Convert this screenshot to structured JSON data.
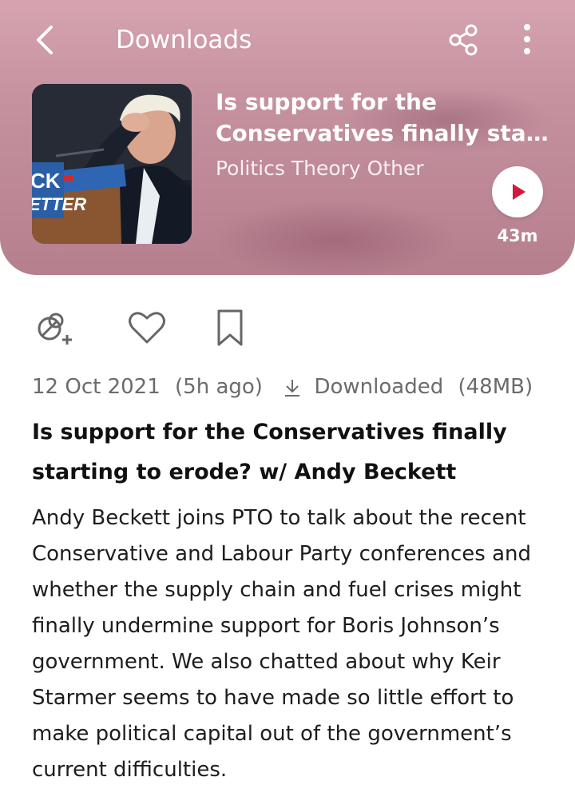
{
  "header": {
    "title": "Downloads"
  },
  "episode": {
    "title_line1": "Is support for the",
    "title_line2": "Conservatives finally starting to erode? w/ Andy Beckett",
    "podcast": "Politics Theory Other",
    "duration": "43m",
    "artwork_text_top": "CK",
    "artwork_text_bottom": "ETTER"
  },
  "meta": {
    "date": "12 Oct 2021",
    "ago": "(5h ago)",
    "status": "Downloaded",
    "size": "(48MB)"
  },
  "body": {
    "title": "Is support for the Conservatives finally starting to erode? w/ Andy Beckett",
    "description": "Andy Beckett joins PTO to talk about the recent Conservative and Labour Party conferences and whether the supply chain and fuel crises might finally undermine support for Boris Johnson’s government. We also chatted about why Keir Starmer seems to have made so little effort to make political capital out of the government’s current difficulties."
  },
  "icons": {
    "back": "back-arrow-icon",
    "share": "share-icon",
    "more": "more-vertical-icon",
    "play": "play-icon",
    "sub": "add-subscription-icon",
    "like": "heart-icon",
    "bookmark": "bookmark-icon",
    "download": "download-icon"
  },
  "colors": {
    "accent": "#d11a3a",
    "header": "#c4909e"
  }
}
